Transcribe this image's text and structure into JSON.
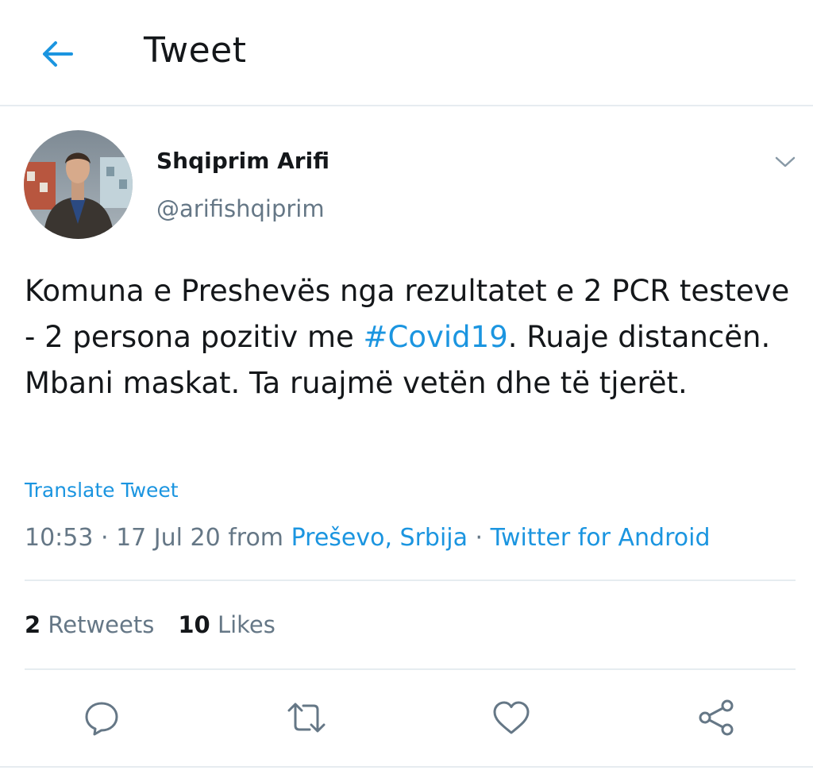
{
  "header": {
    "title": "Tweet",
    "back_icon": "arrow-left-icon"
  },
  "colors": {
    "accent": "#1b95e0",
    "text": "#14171a",
    "secondary": "#657786",
    "divider": "#e6ecf0"
  },
  "author": {
    "display_name": "Shqiprim Arifi",
    "handle": "@arifishqiprim"
  },
  "tweet": {
    "text_before": "Komuna e Preshevës nga rezultatet e 2 PCR testeve - 2 persona pozitiv me ",
    "hashtag": "#Covid19",
    "text_after": ". Ruaje distancën. Mbani maskat. Ta ruajmë vetën dhe të tjerët.",
    "translate_label": "Translate Tweet"
  },
  "meta": {
    "time_date": "10:53 · 17 Jul 20 from ",
    "location": "Preševo, Srbija",
    "separator": " · ",
    "source": "Twitter for Android"
  },
  "stats": {
    "retweets_count": "2",
    "retweets_label": "Retweets",
    "likes_count": "10",
    "likes_label": "Likes"
  },
  "actions": [
    "reply-icon",
    "retweet-icon",
    "like-icon",
    "share-icon"
  ]
}
